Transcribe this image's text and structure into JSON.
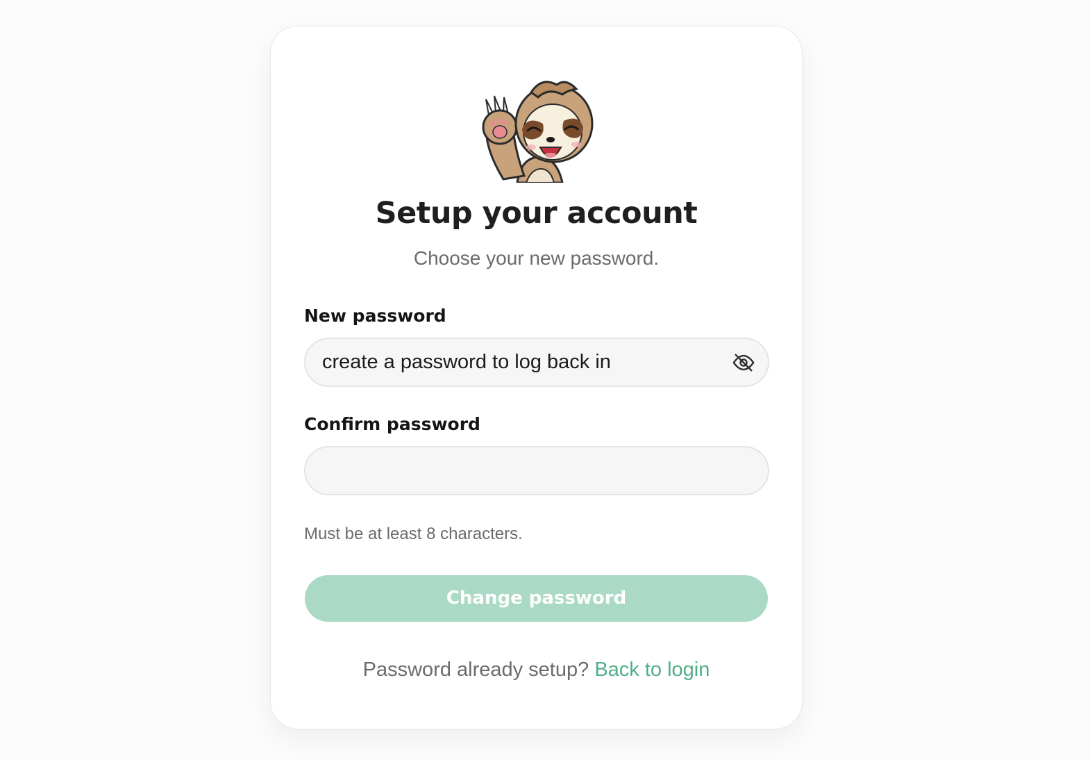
{
  "header": {
    "title": "Setup your account",
    "subtitle": "Choose your new password."
  },
  "mascot": {
    "icon": "waving-sloth-icon"
  },
  "form": {
    "new_password": {
      "label": "New password",
      "value": "create a password to log back in",
      "toggle_icon": "eye-off-icon"
    },
    "confirm_password": {
      "label": "Confirm password",
      "value": ""
    },
    "hint": "Must be at least 8 characters.",
    "submit_label": "Change password"
  },
  "footer": {
    "prompt": "Password already setup?",
    "link_label": "Back to login"
  },
  "colors": {
    "accent": "#4fae88",
    "button_disabled": "#aad9c6",
    "title": "#1f1f1f",
    "muted_text": "#6b6b6b",
    "field_background": "#f5f6f5"
  }
}
